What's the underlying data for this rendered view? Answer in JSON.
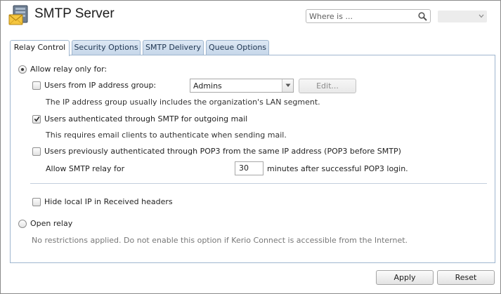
{
  "header": {
    "title": "SMTP Server",
    "search_placeholder": "Where is ..."
  },
  "tabs": [
    {
      "label": "Relay Control",
      "active": true
    },
    {
      "label": "Security Options",
      "active": false
    },
    {
      "label": "SMTP Delivery",
      "active": false
    },
    {
      "label": "Queue Options",
      "active": false
    }
  ],
  "relay": {
    "allow_only_label": "Allow relay only for:",
    "allow_only_selected": true,
    "ip_group": {
      "label": "Users from IP address group:",
      "checked": false,
      "selected_value": "Admins",
      "edit_label": "Edit...",
      "hint": "The IP address group usually includes the organization's LAN segment."
    },
    "smtp_auth": {
      "label": "Users authenticated through SMTP for outgoing mail",
      "checked": true,
      "hint": "This requires email clients to authenticate when sending mail."
    },
    "pop3": {
      "label": "Users previously authenticated through POP3 from the same IP address (POP3 before SMTP)",
      "checked": false,
      "allow_label": "Allow SMTP relay for",
      "minutes_value": "30",
      "minutes_suffix": "minutes after successful POP3 login."
    },
    "hide_ip": {
      "label": "Hide local IP in Received headers",
      "checked": false
    },
    "open_relay": {
      "label": "Open relay",
      "selected": false,
      "hint": "No restrictions applied. Do not enable this option if Kerio Connect is accessible from the Internet."
    }
  },
  "footer": {
    "apply_label": "Apply",
    "reset_label": "Reset"
  },
  "colors": {
    "tab_border": "#9fb6cf",
    "tab_fill": "#c5d6e9",
    "text": "#222222"
  }
}
